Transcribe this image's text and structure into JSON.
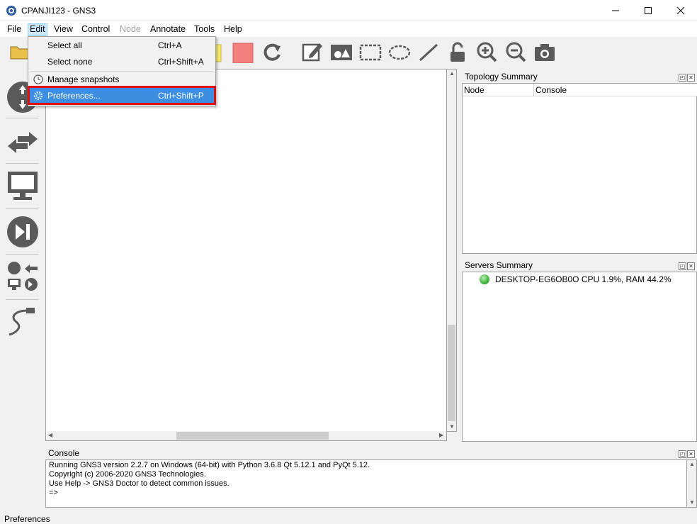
{
  "window": {
    "title": "CPANJI123 - GNS3",
    "controls": [
      "minimize-icon",
      "maximize-icon",
      "close-icon"
    ]
  },
  "menubar": {
    "items": [
      {
        "label": "File",
        "state": "normal"
      },
      {
        "label": "Edit",
        "state": "active"
      },
      {
        "label": "View",
        "state": "normal"
      },
      {
        "label": "Control",
        "state": "normal"
      },
      {
        "label": "Node",
        "state": "disabled"
      },
      {
        "label": "Annotate",
        "state": "normal"
      },
      {
        "label": "Tools",
        "state": "normal"
      },
      {
        "label": "Help",
        "state": "normal"
      }
    ]
  },
  "edit_menu": {
    "items": [
      {
        "label": "Select all",
        "shortcut": "Ctrl+A"
      },
      {
        "label": "Select none",
        "shortcut": "Ctrl+Shift+A"
      },
      {
        "label": "Manage snapshots",
        "shortcut": ""
      },
      {
        "label": "Preferences...",
        "shortcut": "Ctrl+Shift+P",
        "highlighted": true
      }
    ]
  },
  "toolbar": {
    "icons": [
      "open-folder-icon",
      "note-icon",
      "stop-icon",
      "reload-icon",
      "edit-note-icon",
      "insert-picture-icon",
      "draw-rectangle-icon",
      "draw-ellipse-icon",
      "draw-line-icon",
      "lock-icon",
      "zoom-in-icon",
      "zoom-out-icon",
      "screenshot-icon"
    ]
  },
  "left_panel": {
    "icons": [
      "routers-icon",
      "switches-icon",
      "end-devices-icon",
      "security-devices-icon",
      "all-devices-icon",
      "add-link-icon"
    ]
  },
  "topology_summary": {
    "title": "Topology Summary",
    "columns": [
      "Node",
      "Console"
    ]
  },
  "servers_summary": {
    "title": "Servers Summary",
    "server_line": "DESKTOP-EG6OB0O CPU 1.9%, RAM 44.2%",
    "status_color": "#3fb43f"
  },
  "console": {
    "title": "Console",
    "lines": [
      "Running GNS3 version 2.2.7 on Windows (64-bit) with Python 3.6.8 Qt 5.12.1 and PyQt 5.12.",
      "Copyright (c) 2006-2020 GNS3 Technologies.",
      "Use Help -> GNS3 Doctor to detect common issues.",
      "",
      "=>"
    ]
  },
  "statusbar": {
    "text": "Preferences"
  },
  "colors": {
    "menu_highlight": "#3d8ee0",
    "annotation_box": "#e01010",
    "stop_button": "#f47f7f",
    "note_yellow": "#f7e96b"
  }
}
